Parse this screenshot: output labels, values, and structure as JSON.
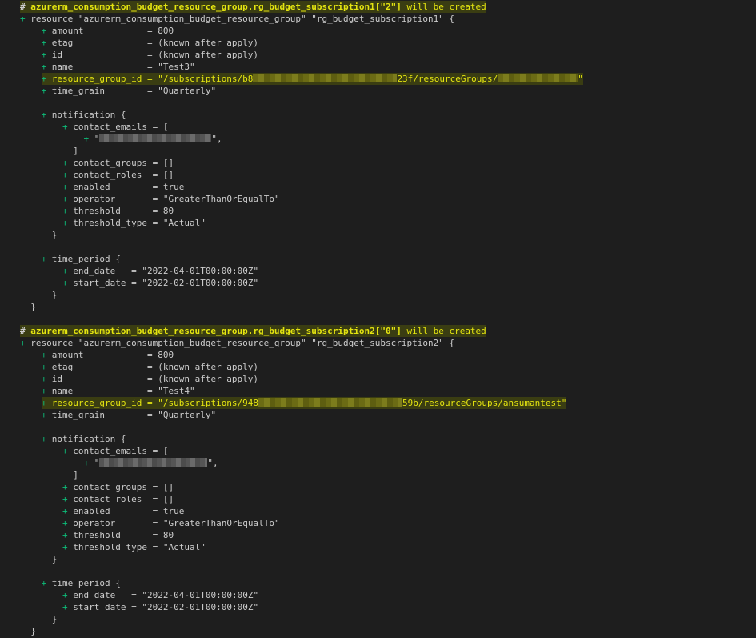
{
  "lines": [
    {
      "indent": 0,
      "hl": true,
      "kind": "comment",
      "prefix": "# ",
      "name": "azurerm_consumption_budget_resource_group.rg_budget_subscription1[\"2\"]",
      "suffix": " will be created"
    },
    {
      "indent": 0,
      "plus": true,
      "text": "resource \"azurerm_consumption_budget_resource_group\" \"rg_budget_subscription1\" {"
    },
    {
      "indent": 4,
      "plus": true,
      "text": "amount            = 800"
    },
    {
      "indent": 4,
      "plus": true,
      "text": "etag              = (known after apply)"
    },
    {
      "indent": 4,
      "plus": true,
      "text": "id                = (known after apply)"
    },
    {
      "indent": 4,
      "plus": true,
      "text": "name              = \"Test3\""
    },
    {
      "indent": 4,
      "plus": true,
      "hl": true,
      "text": "resource_group_id = \"/subscriptions/b8",
      "redactYellow": 180,
      "text2": "23f/resourceGroups/",
      "redactYellow2": 100,
      "text3": "\""
    },
    {
      "indent": 4,
      "plus": true,
      "text": "time_grain        = \"Quarterly\""
    },
    {
      "indent": 0,
      "text": ""
    },
    {
      "indent": 4,
      "plus": true,
      "text": "notification {"
    },
    {
      "indent": 8,
      "plus": true,
      "text": "contact_emails = ["
    },
    {
      "indent": 12,
      "plus": true,
      "text": "\"",
      "redact": 140,
      "text2": "\","
    },
    {
      "indent": 10,
      "text": "]"
    },
    {
      "indent": 8,
      "plus": true,
      "text": "contact_groups = []"
    },
    {
      "indent": 8,
      "plus": true,
      "text": "contact_roles  = []"
    },
    {
      "indent": 8,
      "plus": true,
      "text": "enabled        = true"
    },
    {
      "indent": 8,
      "plus": true,
      "text": "operator       = \"GreaterThanOrEqualTo\""
    },
    {
      "indent": 8,
      "plus": true,
      "text": "threshold      = 80"
    },
    {
      "indent": 8,
      "plus": true,
      "text": "threshold_type = \"Actual\""
    },
    {
      "indent": 6,
      "text": "}"
    },
    {
      "indent": 0,
      "text": ""
    },
    {
      "indent": 4,
      "plus": true,
      "text": "time_period {"
    },
    {
      "indent": 8,
      "plus": true,
      "text": "end_date   = \"2022-04-01T00:00:00Z\""
    },
    {
      "indent": 8,
      "plus": true,
      "text": "start_date = \"2022-02-01T00:00:00Z\""
    },
    {
      "indent": 6,
      "text": "}"
    },
    {
      "indent": 2,
      "text": "}"
    },
    {
      "indent": 0,
      "text": ""
    },
    {
      "indent": 0,
      "hl": true,
      "kind": "comment",
      "prefix": "# ",
      "name": "azurerm_consumption_budget_resource_group.rg_budget_subscription2[\"0\"]",
      "suffix": " will be created"
    },
    {
      "indent": 0,
      "plus": true,
      "text": "resource \"azurerm_consumption_budget_resource_group\" \"rg_budget_subscription2\" {"
    },
    {
      "indent": 4,
      "plus": true,
      "text": "amount            = 800"
    },
    {
      "indent": 4,
      "plus": true,
      "text": "etag              = (known after apply)"
    },
    {
      "indent": 4,
      "plus": true,
      "text": "id                = (known after apply)"
    },
    {
      "indent": 4,
      "plus": true,
      "text": "name              = \"Test4\""
    },
    {
      "indent": 4,
      "plus": true,
      "hl": true,
      "text": "resource_group_id = \"/subscriptions/948",
      "redactYellow": 180,
      "text2": "59b/resourceGroups/ansumantest\""
    },
    {
      "indent": 4,
      "plus": true,
      "text": "time_grain        = \"Quarterly\""
    },
    {
      "indent": 0,
      "text": ""
    },
    {
      "indent": 4,
      "plus": true,
      "text": "notification {"
    },
    {
      "indent": 8,
      "plus": true,
      "text": "contact_emails = ["
    },
    {
      "indent": 12,
      "plus": true,
      "text": "\"",
      "redact": 135,
      "text2": "\","
    },
    {
      "indent": 10,
      "text": "]"
    },
    {
      "indent": 8,
      "plus": true,
      "text": "contact_groups = []"
    },
    {
      "indent": 8,
      "plus": true,
      "text": "contact_roles  = []"
    },
    {
      "indent": 8,
      "plus": true,
      "text": "enabled        = true"
    },
    {
      "indent": 8,
      "plus": true,
      "text": "operator       = \"GreaterThanOrEqualTo\""
    },
    {
      "indent": 8,
      "plus": true,
      "text": "threshold      = 80"
    },
    {
      "indent": 8,
      "plus": true,
      "text": "threshold_type = \"Actual\""
    },
    {
      "indent": 6,
      "text": "}"
    },
    {
      "indent": 0,
      "text": ""
    },
    {
      "indent": 4,
      "plus": true,
      "text": "time_period {"
    },
    {
      "indent": 8,
      "plus": true,
      "text": "end_date   = \"2022-04-01T00:00:00Z\""
    },
    {
      "indent": 8,
      "plus": true,
      "text": "start_date = \"2022-02-01T00:00:00Z\""
    },
    {
      "indent": 6,
      "text": "}"
    },
    {
      "indent": 2,
      "text": "}"
    }
  ],
  "colors": {
    "background": "#1e1e1e",
    "text": "#cccccc",
    "plus": "#0dbc79",
    "comment_name": "#e5e510",
    "highlight": "#3a3d12"
  }
}
